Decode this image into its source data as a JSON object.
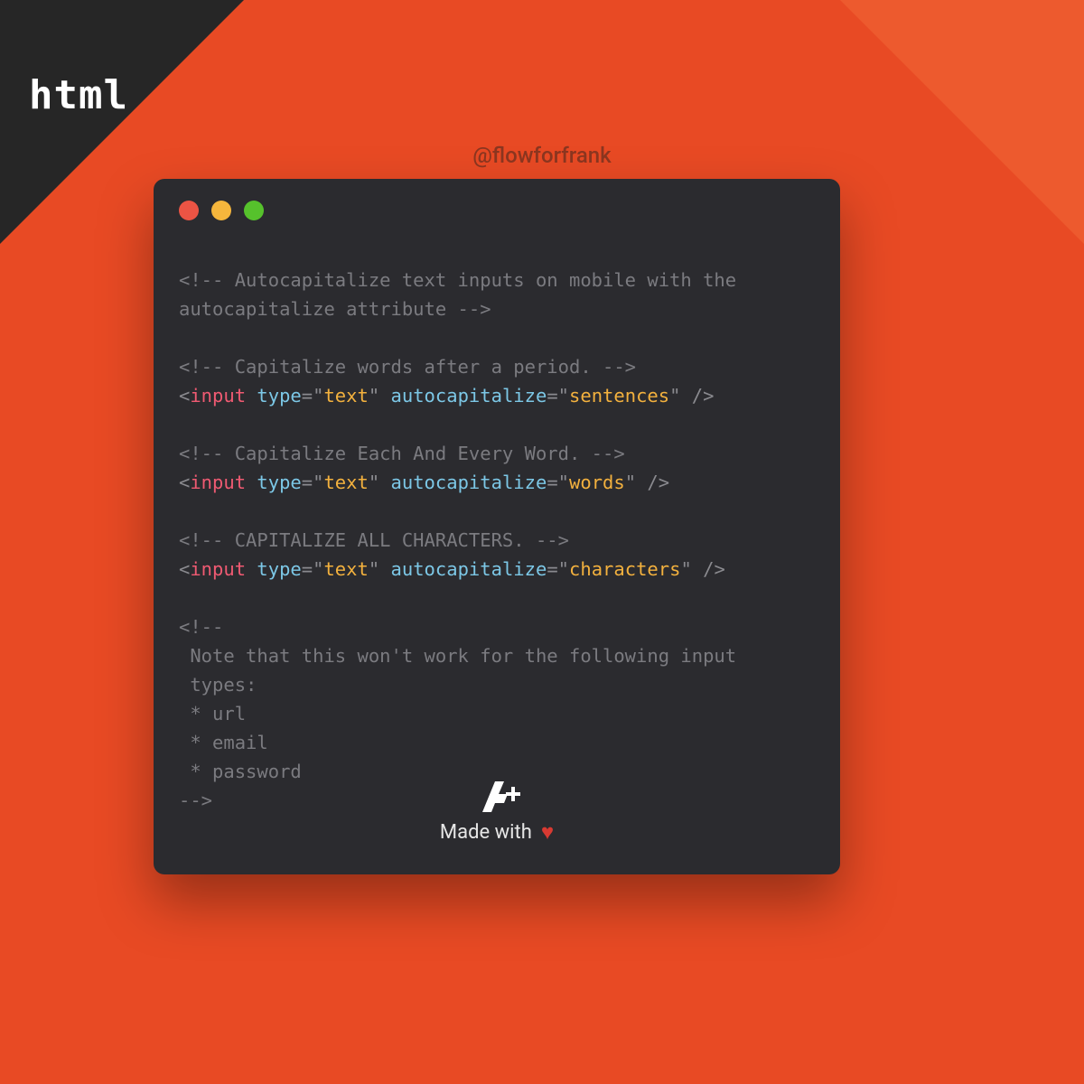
{
  "badge": "html",
  "handle": "@flowforfrank",
  "lines": {
    "c1a": "<!-- Autocapitalize text inputs on mobile with the",
    "c1b": "autocapitalize attribute -->",
    "c2": "<!-- Capitalize words after a period. -->",
    "c3": "<!-- Capitalize Each And Every Word. -->",
    "c4": "<!-- CAPITALIZE ALL CHARACTERS. -->",
    "c5a": "<!--",
    "c5b": " Note that this won't work for the following input",
    "c5c": " types:",
    "c5d": " * url",
    "c5e": " * email",
    "c5f": " * password",
    "c5g": "-->"
  },
  "tokens": {
    "lt": "<",
    "gt": "/>",
    "tag": "input",
    "attr_type": "type",
    "attr_cap": "autocapitalize",
    "eq": "=",
    "q": "\"",
    "val_text": "text",
    "val_sent": "sentences",
    "val_words": "words",
    "val_chars": "characters"
  },
  "footer": {
    "logo": "A+",
    "made": "Made with",
    "heart": "♥"
  }
}
